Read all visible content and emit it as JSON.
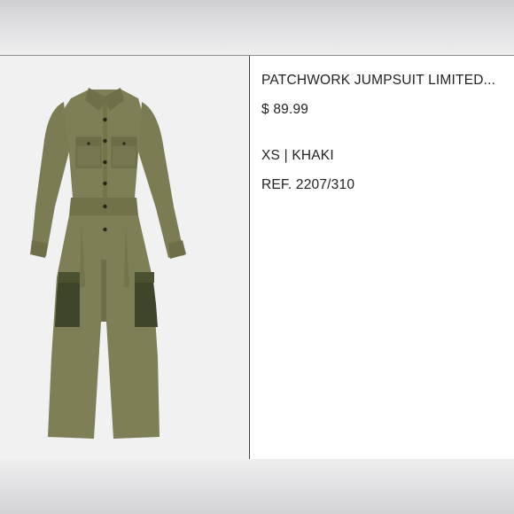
{
  "product": {
    "title": "PATCHWORK JUMPSUIT LIMITED...",
    "price": "$ 89.99",
    "variant": "XS | KHAKI",
    "reference": "REF. 2207/310"
  },
  "colors": {
    "garment": "#7c7d55",
    "garment_shadow": "#696a45",
    "pocket_patch": "#3e4427",
    "button": "#2b2218",
    "background": "#f1f1f1"
  },
  "image": {
    "subject": "khaki utility jumpsuit with dark cargo pocket patches"
  }
}
